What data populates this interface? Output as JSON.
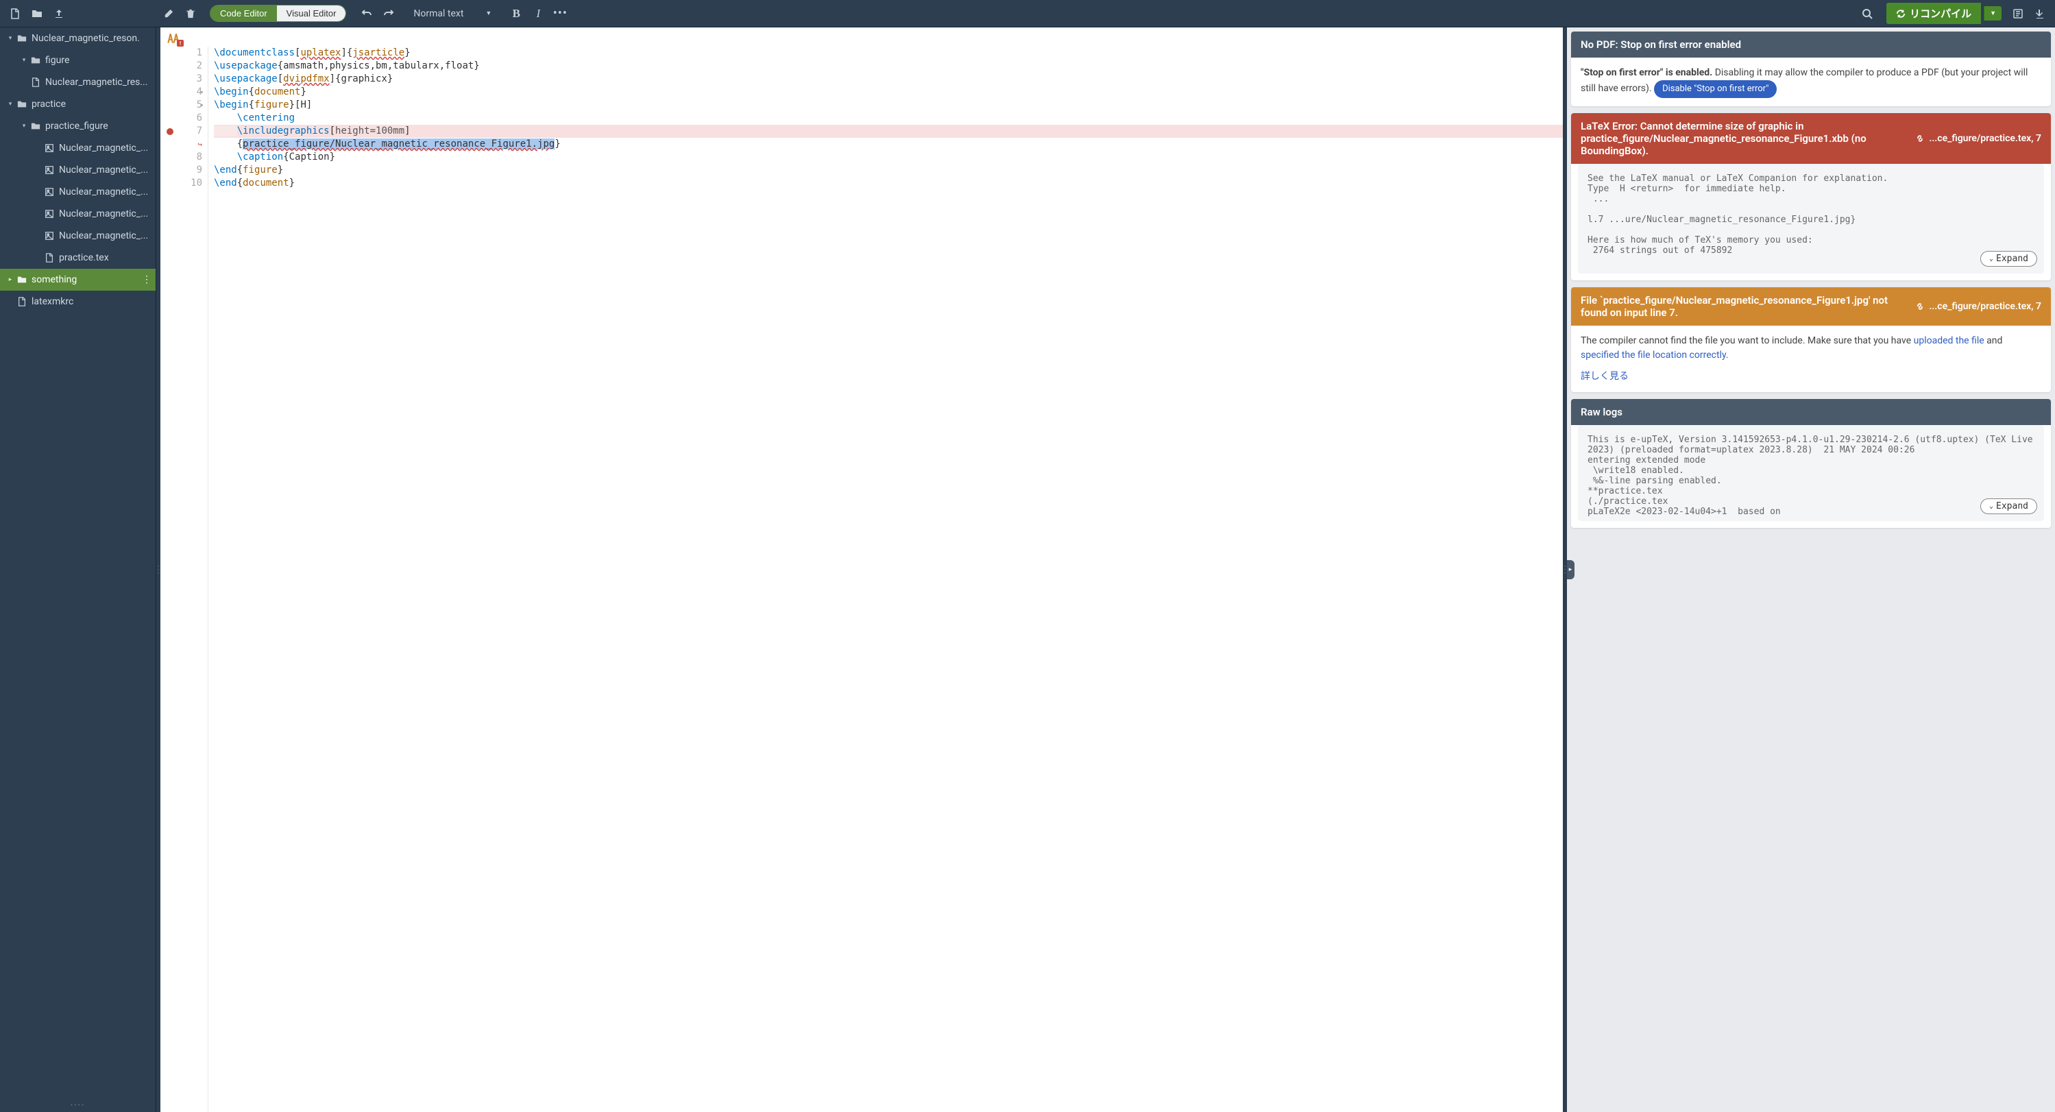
{
  "toolbar": {
    "code_editor": "Code Editor",
    "visual_editor": "Visual Editor",
    "text_style": "Normal text",
    "recompile": "リコンパイル"
  },
  "tree": [
    {
      "indent": 0,
      "chev": "▾",
      "icon": "folder",
      "label": "Nuclear_magnetic_reson.",
      "sel": false
    },
    {
      "indent": 1,
      "chev": "▾",
      "icon": "folder",
      "label": "figure",
      "sel": false
    },
    {
      "indent": 1,
      "chev": "",
      "icon": "file",
      "label": "Nuclear_magnetic_res...",
      "sel": false
    },
    {
      "indent": 0,
      "chev": "▾",
      "icon": "folder",
      "label": "practice",
      "sel": false
    },
    {
      "indent": 1,
      "chev": "▾",
      "icon": "folder",
      "label": "practice_figure",
      "sel": false
    },
    {
      "indent": 2,
      "chev": "",
      "icon": "image",
      "label": "Nuclear_magnetic_...",
      "sel": false
    },
    {
      "indent": 2,
      "chev": "",
      "icon": "image",
      "label": "Nuclear_magnetic_...",
      "sel": false
    },
    {
      "indent": 2,
      "chev": "",
      "icon": "image",
      "label": "Nuclear_magnetic_...",
      "sel": false
    },
    {
      "indent": 2,
      "chev": "",
      "icon": "image",
      "label": "Nuclear_magnetic_...",
      "sel": false
    },
    {
      "indent": 2,
      "chev": "",
      "icon": "image",
      "label": "Nuclear_magnetic_...",
      "sel": false
    },
    {
      "indent": 2,
      "chev": "",
      "icon": "file",
      "label": "practice.tex",
      "sel": false
    },
    {
      "indent": 0,
      "chev": "▸",
      "icon": "folder",
      "label": "something",
      "sel": true
    },
    {
      "indent": 0,
      "chev": "",
      "icon": "file",
      "label": "latexmkrc",
      "sel": false
    }
  ],
  "editor": {
    "error_line": 7,
    "lines": [
      {
        "n": 1,
        "html": "<span class='tk-cmd'>\\documentclass</span>[<span class='tk-opt underline-err'>uplatex</span>]{<span class='tk-opt underline-err'>jsarticle</span>}"
      },
      {
        "n": 2,
        "html": "<span class='tk-cmd'>\\usepackage</span>{amsmath,physics,bm,tabularx,float}"
      },
      {
        "n": 3,
        "html": "<span class='tk-cmd'>\\usepackage</span>[<span class='tk-opt underline-err'>dvipdfmx</span>]{graphicx}"
      },
      {
        "n": 4,
        "fold": true,
        "html": "<span class='tk-cmd'>\\begin</span>{<span class='tk-opt'>document</span>}"
      },
      {
        "n": 5,
        "fold": true,
        "html": "<span class='tk-cmd'>\\begin</span>{<span class='tk-opt'>figure</span>}[H]"
      },
      {
        "n": 6,
        "html": "    <span class='tk-cmd'>\\centering</span>"
      },
      {
        "n": 7,
        "err": true,
        "html": "<span class='hl-err'><span class='indent-ws'>    </span><span class='tk-cmd'>\\includegraphics</span>[<span class='tk-arg'>height=100mm</span>]</span>"
      },
      {
        "n": "",
        "arrow": true,
        "html": "    {<span class='hl-sel underline-err'>practice_figure/Nuclear_magnetic_resonance_Figure1.jpg</span>}"
      },
      {
        "n": 8,
        "html": "    <span class='tk-cmd'>\\caption</span>{Caption}"
      },
      {
        "n": 9,
        "html": "<span class='tk-cmd'>\\end</span>{<span class='tk-opt'>figure</span>}"
      },
      {
        "n": 10,
        "html": "<span class='tk-cmd'>\\end</span>{<span class='tk-opt'>document</span>}"
      }
    ]
  },
  "logs": {
    "no_pdf_title": "No PDF: Stop on first error enabled",
    "no_pdf_body_strong": "\"Stop on first error\" is enabled.",
    "no_pdf_body_rest": " Disabling it may allow the compiler to produce a PDF (but your project will still have errors). ",
    "disable_btn": "Disable \"Stop on first error\"",
    "err1_title": "LaTeX Error: Cannot determine size of graphic in practice_figure/Nuclear_magnetic_resonance_Figure1.xbb (no BoundingBox).",
    "err1_loc": "...ce_figure/practice.tex, 7",
    "err1_log": "See the LaTeX manual or LaTeX Companion for explanation.\nType  H <return>  for immediate help.\n ...\n\nl.7 ...ure/Nuclear_magnetic_resonance_Figure1.jpg}\n\nHere is how much of TeX's memory you used:\n 2764 strings out of 475892",
    "expand": "Expand",
    "warn1_title": "File `practice_figure/Nuclear_magnetic_resonance_Figure1.jpg' not found on input line 7.",
    "warn1_loc": "...ce_figure/practice.tex, 7",
    "warn1_body_a": "The compiler cannot find the file you want to include. Make sure that you have ",
    "warn1_link1": "uploaded the file",
    "warn1_body_b": " and ",
    "warn1_link2": "specified the file location correctly",
    "warn1_more": "詳しく見る",
    "raw_title": "Raw logs",
    "raw_log": "This is e-upTeX, Version 3.141592653-p4.1.0-u1.29-230214-2.6 (utf8.uptex) (TeX Live 2023) (preloaded format=uplatex 2023.8.28)  21 MAY 2024 00:26\nentering extended mode\n \\write18 enabled.\n %&-line parsing enabled.\n**practice.tex\n(./practice.tex\npLaTeX2e <2023-02-14u04>+1  based on"
  }
}
